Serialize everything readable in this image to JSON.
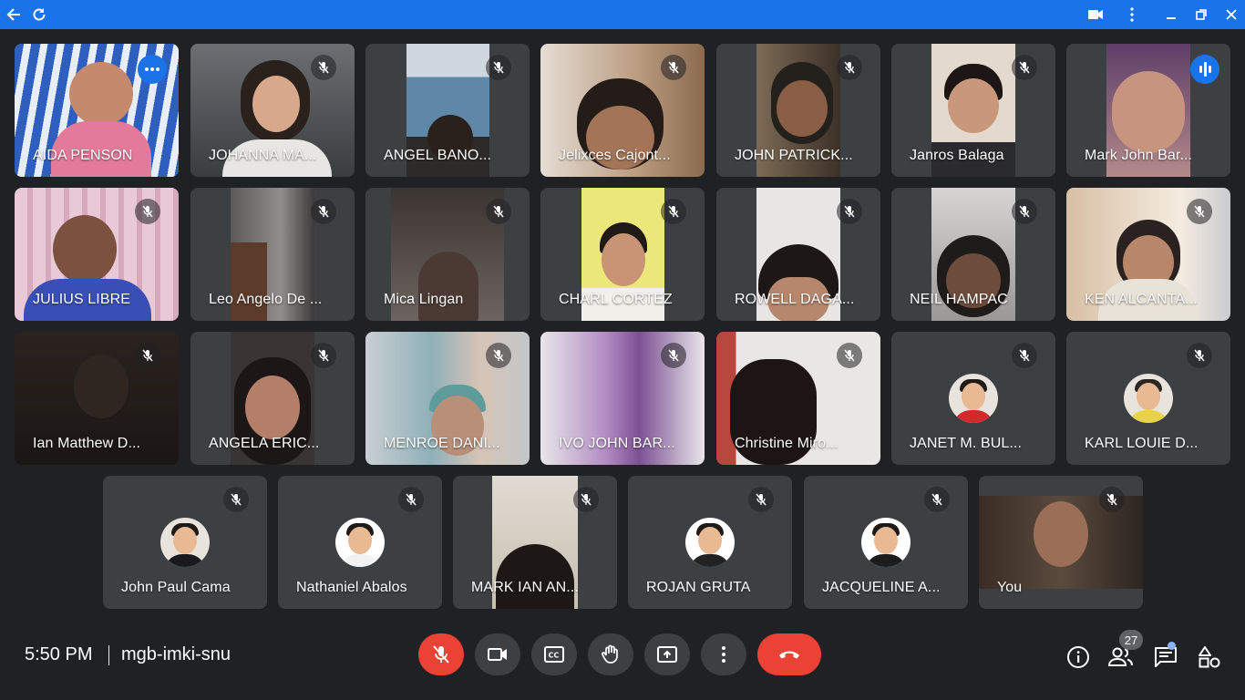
{
  "browser": {
    "icons": [
      "back-arrow-icon",
      "reload-icon",
      "camera-icon",
      "kebab-menu-icon",
      "minimize-icon",
      "restore-icon",
      "close-icon"
    ],
    "accent": "#1a73e8"
  },
  "participants": [
    {
      "name": "AIDA PENSON",
      "muted": false,
      "speaking_highlight": true,
      "options_button": true
    },
    {
      "name": "JOHANNA MA...",
      "muted": true
    },
    {
      "name": "ANGEL BANO...",
      "muted": true
    },
    {
      "name": "Jelixces Cajont...",
      "muted": true
    },
    {
      "name": "JOHN PATRICK...",
      "muted": true
    },
    {
      "name": "Janros Balaga",
      "muted": true
    },
    {
      "name": "Mark John Bar...",
      "muted": false,
      "audio_indicator": true
    },
    {
      "name": "JULIUS LIBRE",
      "muted": true
    },
    {
      "name": "Leo Angelo De ...",
      "muted": true
    },
    {
      "name": "Mica Lingan",
      "muted": true
    },
    {
      "name": "CHARL CORTEZ",
      "muted": true
    },
    {
      "name": "ROWELL DAGA...",
      "muted": true
    },
    {
      "name": "NEIL HAMPAC",
      "muted": true
    },
    {
      "name": "KEN ALCANTA...",
      "muted": true
    },
    {
      "name": "Ian Matthew D...",
      "muted": true
    },
    {
      "name": "ANGELA ERIC...",
      "muted": true
    },
    {
      "name": "MENROE DANI...",
      "muted": true
    },
    {
      "name": "IVO JOHN BAR...",
      "muted": true
    },
    {
      "name": "Christine Miro...",
      "muted": true
    },
    {
      "name": "JANET M. BUL...",
      "muted": true,
      "avatar": true
    },
    {
      "name": "KARL LOUIE D...",
      "muted": true,
      "avatar": true
    },
    {
      "name": "John Paul Cama",
      "muted": true,
      "avatar": true
    },
    {
      "name": "Nathaniel Abalos",
      "muted": true,
      "avatar": true
    },
    {
      "name": "MARK IAN AN...",
      "muted": true
    },
    {
      "name": "ROJAN GRUTA",
      "muted": true,
      "avatar": true
    },
    {
      "name": "JACQUELINE A...",
      "muted": true,
      "avatar": true
    },
    {
      "name": "You",
      "muted": true
    }
  ],
  "bottom_bar": {
    "time": "5:50 PM",
    "meeting_code": "mgb-imki-snu",
    "controls": [
      "mic-off-icon",
      "camera-icon",
      "captions-icon",
      "raise-hand-icon",
      "present-screen-icon",
      "more-options-icon",
      "end-call-icon"
    ],
    "right_icons": [
      "info-icon",
      "people-icon",
      "chat-icon",
      "activities-icon"
    ],
    "participant_count": "27"
  }
}
